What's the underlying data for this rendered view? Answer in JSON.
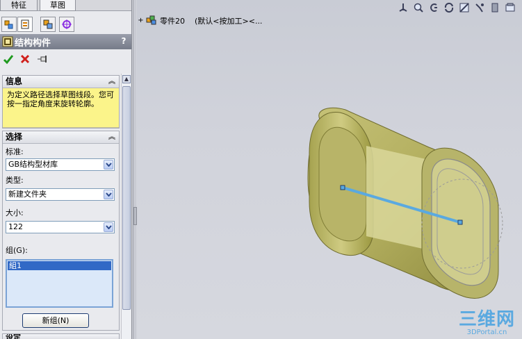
{
  "tabs": [
    "特征",
    "草图"
  ],
  "icon_tabs": [
    "feature-manager-icon",
    "property-manager-icon",
    "configuration-manager-icon",
    "dimxpert-icon"
  ],
  "property_manager": {
    "title": "结构构件",
    "help": "?",
    "actions": [
      "ok-check-icon",
      "cancel-x-icon",
      "pushpin-icon"
    ]
  },
  "info_group": {
    "title": "信息",
    "text": "为定义路径选择草图线段。您可按一指定角度来旋转轮廓。"
  },
  "selection_group": {
    "title": "选择",
    "standard_label": "标准:",
    "standard_value": "GB结构型材库",
    "type_label": "类型:",
    "type_value": "新建文件夹",
    "size_label": "大小:",
    "size_value": "122",
    "group_label": "组(G):",
    "group_items": [
      "組1"
    ],
    "new_group_button": "新组(N)"
  },
  "settings_group": {
    "title": "设定"
  },
  "tree": {
    "expander": "+",
    "part_name": "零件20",
    "config": "(默认<按加工><..."
  },
  "toolbar": [
    "view-orientation-icon",
    "zoom-to-fit-icon",
    "zoom-area-icon",
    "rotate-icon",
    "section-view-icon",
    "edit-appearance-icon",
    "display-style-icon",
    "hide-show-icon"
  ],
  "watermark": {
    "line1": "三维网",
    "line2": "3DPortal.cn"
  },
  "colors": {
    "accent": "#3169c6",
    "info_bg": "#fbf48a",
    "model": "#b5b15a",
    "sketch_line": "#5aa9e0"
  }
}
